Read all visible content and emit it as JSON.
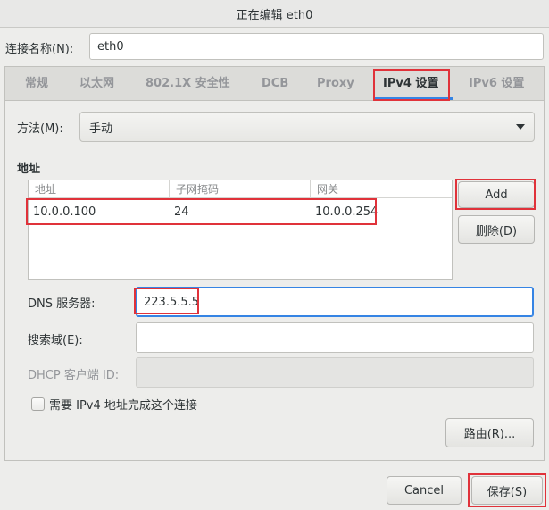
{
  "window": {
    "title": "正在编辑 eth0"
  },
  "connection": {
    "label": "连接名称(N):",
    "value": "eth0"
  },
  "tabs": [
    {
      "label": "常规",
      "active": false
    },
    {
      "label": "以太网",
      "active": false
    },
    {
      "label": "802.1X 安全性",
      "active": false
    },
    {
      "label": "DCB",
      "active": false
    },
    {
      "label": "Proxy",
      "active": false
    },
    {
      "label": "IPv4 设置",
      "active": true
    },
    {
      "label": "IPv6 设置",
      "active": false
    }
  ],
  "method": {
    "label": "方法(M):",
    "value": "手动"
  },
  "addresses": {
    "heading": "地址",
    "columns": [
      "地址",
      "子网掩码",
      "网关"
    ],
    "rows": [
      {
        "address": "10.0.0.100",
        "netmask": "24",
        "gateway": "10.0.0.254"
      }
    ],
    "add_label": "Add",
    "delete_label": "删除(D)"
  },
  "dns": {
    "label": "DNS 服务器:",
    "value": "223.5.5.5"
  },
  "search_domains": {
    "label": "搜索域(E):",
    "value": ""
  },
  "dhcp_client_id": {
    "label": "DHCP 客户端 ID:",
    "value": ""
  },
  "require_ipv4": {
    "label": "需要 IPv4 地址完成这个连接",
    "checked": false
  },
  "routes_label": "路由(R)...",
  "footer": {
    "cancel_label": "Cancel",
    "save_label": "保存(S)"
  },
  "colors": {
    "highlight": "#e0323a",
    "accent": "#3584e4"
  }
}
